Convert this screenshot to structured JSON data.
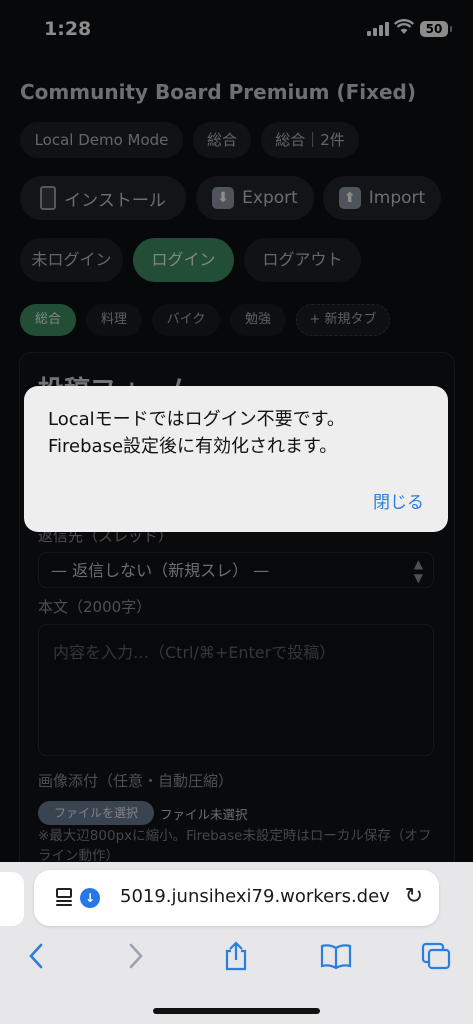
{
  "status_bar": {
    "time": "1:28",
    "battery": "50"
  },
  "page": {
    "title": "Community Board Premium (Fixed)",
    "chips": [
      "Local Demo Mode",
      "総合",
      "総合｜2件"
    ],
    "actions": {
      "install": "インストール",
      "export": "Export",
      "import": "Import"
    },
    "auth": {
      "status": "未ログイン",
      "login": "ログイン",
      "logout": "ログアウト"
    },
    "tabs": [
      "総合",
      "料理",
      "バイク",
      "勉強",
      "+ 新規タブ"
    ],
    "form": {
      "heading": "投稿フォーム",
      "reply_label": "返信先（スレッド）",
      "reply_value": "— 返信しない（新規スレ） —",
      "body_label": "本文（2000字）",
      "body_placeholder": "内容を入力…（Ctrl/⌘+Enterで投稿）",
      "image_label": "画像添付（任意・自動圧縮）",
      "file_button": "ファイルを選択",
      "file_status": "ファイル未選択",
      "hint": "※最大辺800pxに縮小。Firebase未設定時はローカル保存（オフライン動作）"
    }
  },
  "alert": {
    "message_line1": "Localモードではログイン不要です。",
    "message_line2": "Firebase設定後に有効化されます。",
    "close": "閉じる"
  },
  "browser": {
    "url": "5019.junsihexi79.workers.dev"
  },
  "colors": {
    "accent_green": "#3f8f61",
    "link_blue": "#2a7ee0",
    "download_badge": "#2478e8"
  }
}
